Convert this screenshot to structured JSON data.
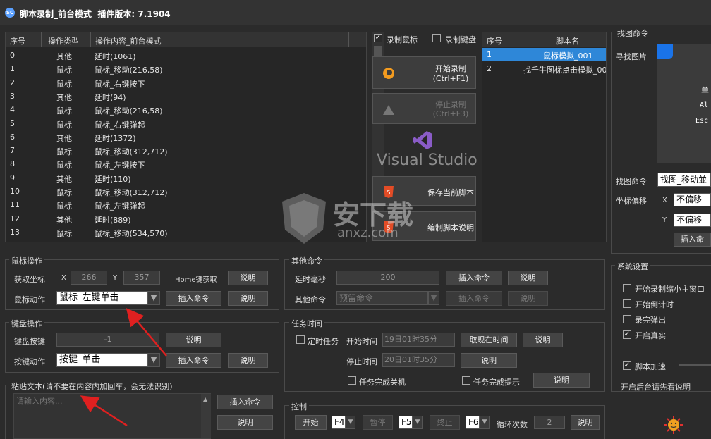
{
  "window": {
    "app_icon": "app-icon",
    "title": "脚本录制_前台模式",
    "version_label": "插件版本: 7.1904"
  },
  "ops_table": {
    "headers": [
      "序号",
      "操作类型",
      "操作内容_前台模式"
    ],
    "rows": [
      [
        "0",
        "其他",
        "延时(1061)"
      ],
      [
        "1",
        "鼠标",
        "鼠标_移动(216,58)"
      ],
      [
        "2",
        "鼠标",
        "鼠标_右键按下"
      ],
      [
        "3",
        "其他",
        "延时(94)"
      ],
      [
        "4",
        "鼠标",
        "鼠标_移动(216,58)"
      ],
      [
        "5",
        "鼠标",
        "鼠标_右键弹起"
      ],
      [
        "6",
        "其他",
        "延时(1372)"
      ],
      [
        "7",
        "鼠标",
        "鼠标_移动(312,712)"
      ],
      [
        "8",
        "鼠标",
        "鼠标_左键按下"
      ],
      [
        "9",
        "其他",
        "延时(110)"
      ],
      [
        "10",
        "鼠标",
        "鼠标_移动(312,712)"
      ],
      [
        "11",
        "鼠标",
        "鼠标_左键弹起"
      ],
      [
        "12",
        "其他",
        "延时(889)"
      ],
      [
        "13",
        "鼠标",
        "鼠标_移动(534,570)"
      ]
    ]
  },
  "record": {
    "record_mouse": "录制鼠标",
    "record_keyboard": "录制键盘",
    "start": "开始录制",
    "start_key": "(Ctrl+F1)",
    "stop": "停止录制",
    "stop_key": "(Ctrl+F3)",
    "vs_text": "Visual Studio",
    "save": "保存当前脚本",
    "edit_desc": "编制脚本说明"
  },
  "script_table": {
    "headers": [
      "序号",
      "脚本名"
    ],
    "rows": [
      [
        "1",
        "鼠标模拟_001"
      ],
      [
        "2",
        "找千牛图标点击模拟_00"
      ]
    ]
  },
  "find_cmd": {
    "group": "找图命令",
    "find_image": "寻找图片",
    "preview_lines": [
      "单",
      "Al",
      "Esc"
    ],
    "cmd_label": "找图命令",
    "cmd_value": "找图_移动並",
    "offset_label": "坐标偏移",
    "x": "X",
    "y": "Y",
    "x_value": "不偏移",
    "y_value": "不偏移",
    "insert": "插入命"
  },
  "mouse_op": {
    "group": "鼠标操作",
    "get_coord": "获取坐标",
    "x": "X",
    "x_value": "266",
    "y": "Y",
    "y_value": "357",
    "home_get": "Home键获取",
    "desc": "说明",
    "action_label": "鼠标动作",
    "action_value": "鼠标_左键单击",
    "insert": "插入命令"
  },
  "other_cmd": {
    "group": "其他命令",
    "delay_label": "延时毫秒",
    "delay_value": "200",
    "insert": "插入命令",
    "desc": "说明",
    "other_label": "其他命令",
    "other_value": "预留命令"
  },
  "keyboard_op": {
    "group": "键盘操作",
    "key_label": "键盘按键",
    "key_value": "-1",
    "desc": "说明",
    "action_label": "按键动作",
    "action_value": "按键_单击",
    "insert": "插入命令"
  },
  "task_time": {
    "group": "任务时间",
    "timed": "定时任务",
    "start_label": "开始时间",
    "start_value": "19日01时35分",
    "get_now": "取现在时间",
    "desc": "说明",
    "stop_label": "停止时间",
    "stop_value": "20日01时35分",
    "shutdown": "任务完成关机",
    "prompt": "任务完成提示"
  },
  "paste": {
    "group": "粘贴文本(请不要在内容内加回车，会无法识别)",
    "placeholder": "请输入内容...",
    "insert": "插入命令",
    "desc": "说明"
  },
  "control": {
    "group": "控制",
    "start": "开始",
    "start_key": "F4",
    "pause": "暂停",
    "pause_key": "F5",
    "stop": "终止",
    "stop_key": "F6",
    "loop_label": "循环次数",
    "loop_value": "2",
    "desc": "说明"
  },
  "settings": {
    "group": "系统设置",
    "opt1": "开始录制缩小主窗口",
    "opt2": "开始倒计时",
    "opt3": "录完弹出",
    "opt4": "开启真实",
    "speed": "脚本加速",
    "note": "开启后台请先看说明"
  },
  "watermark": {
    "line1": "安下载",
    "line2": "anxz.com"
  },
  "colors": {
    "accent": "#2e87d8",
    "vs_purple": "#8a5cc7",
    "arrow_red": "#e02020"
  }
}
